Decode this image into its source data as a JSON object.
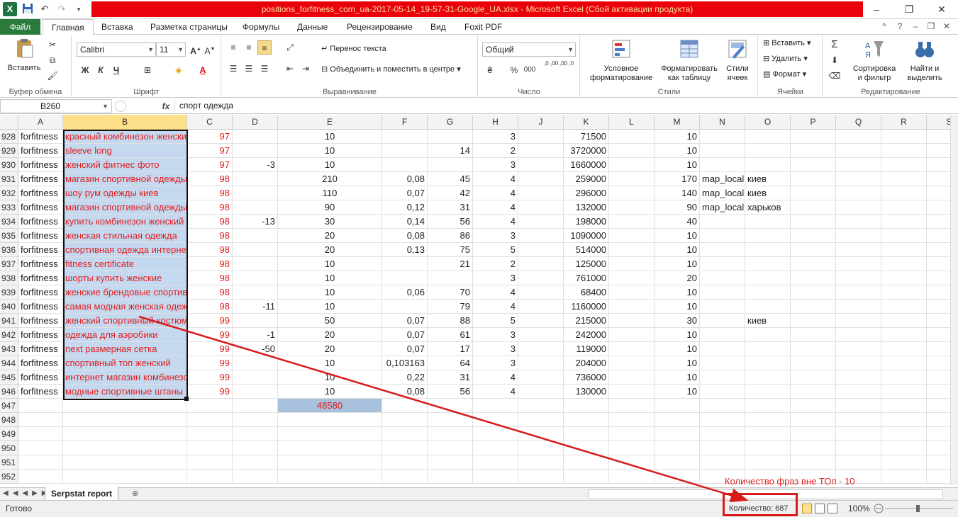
{
  "window": {
    "title": "positions_forfitness_com_ua-2017-05-14_19-57-31-Google_UA.xlsx  -  Microsoft Excel (Сбой активации продукта)",
    "app_icon": "X",
    "minimize": "–",
    "restore": "❐",
    "close": "✕"
  },
  "tabs": {
    "file": "Файл",
    "items": [
      "Главная",
      "Вставка",
      "Разметка страницы",
      "Формулы",
      "Данные",
      "Рецензирование",
      "Вид",
      "Foxit PDF"
    ]
  },
  "ribbon": {
    "clipboard": {
      "label": "Буфер обмена",
      "paste": "Вставить"
    },
    "font": {
      "label": "Шрифт",
      "name": "Calibri",
      "size": "11",
      "bold": "Ж",
      "italic": "К",
      "underline": "Ч"
    },
    "alignment": {
      "label": "Выравнивание",
      "wrap": "Перенос текста",
      "merge": "Объединить и поместить в центре"
    },
    "number": {
      "label": "Число",
      "format": "Общий",
      "percent": "%",
      "thousands": "000",
      "inc_decimal": ",0 ,00",
      "dec_decimal": ",00 ,0"
    },
    "styles": {
      "label": "Стили",
      "conditional": [
        "Условное",
        "форматирование"
      ],
      "as_table": [
        "Форматировать",
        "как таблицу"
      ],
      "cell_styles": [
        "Стили",
        "ячеек"
      ]
    },
    "cells": {
      "label": "Ячейки",
      "insert": "Вставить",
      "delete": "Удалить",
      "format": "Формат"
    },
    "editing": {
      "label": "Редактирование",
      "sort": [
        "Сортировка",
        "и фильтр"
      ],
      "find": [
        "Найти и",
        "выделить"
      ],
      "sigma": "Σ"
    }
  },
  "formula_bar": {
    "name_box": "B260",
    "fx": "fx",
    "content": "спорт одежда"
  },
  "columns": [
    "A",
    "B",
    "C",
    "D",
    "E",
    "F",
    "G",
    "H",
    "J",
    "K",
    "L",
    "M",
    "N",
    "O",
    "P",
    "Q",
    "R",
    "S"
  ],
  "rows": [
    {
      "n": "928",
      "a": "forfitness",
      "b": "красный комбинезон женский",
      "c": "97",
      "d": "",
      "e": "10",
      "f": "",
      "g": "",
      "h": "3",
      "k": "71500",
      "m": "10",
      "n2": "",
      "o": ""
    },
    {
      "n": "929",
      "a": "forfitness",
      "b": "sleeve long",
      "c": "97",
      "d": "",
      "e": "10",
      "f": "",
      "g": "14",
      "h": "2",
      "k": "3720000",
      "m": "10",
      "n2": "",
      "o": ""
    },
    {
      "n": "930",
      "a": "forfitness",
      "b": "женский фитнес фото",
      "c": "97",
      "d": "-3",
      "e": "10",
      "f": "",
      "g": "",
      "h": "3",
      "k": "1660000",
      "m": "10",
      "n2": "",
      "o": ""
    },
    {
      "n": "931",
      "a": "forfitness",
      "b": "магазин спортивной одежды",
      "c": "98",
      "d": "",
      "e": "210",
      "f": "0,08",
      "g": "45",
      "h": "4",
      "k": "259000",
      "m": "170",
      "n2": "map_local",
      "o": "киев"
    },
    {
      "n": "932",
      "a": "forfitness",
      "b": "шоу рум одежды киев",
      "c": "98",
      "d": "",
      "e": "110",
      "f": "0,07",
      "g": "42",
      "h": "4",
      "k": "296000",
      "m": "140",
      "n2": "map_local",
      "o": "киев"
    },
    {
      "n": "933",
      "a": "forfitness",
      "b": "магазин спортивной одежды",
      "c": "98",
      "d": "",
      "e": "90",
      "f": "0,12",
      "g": "31",
      "h": "4",
      "k": "132000",
      "m": "90",
      "n2": "map_local",
      "o": "харьков"
    },
    {
      "n": "934",
      "a": "forfitness",
      "b": "купить комбинезон женский",
      "c": "98",
      "d": "-13",
      "e": "30",
      "f": "0,14",
      "g": "56",
      "h": "4",
      "k": "198000",
      "m": "40",
      "n2": "",
      "o": ""
    },
    {
      "n": "935",
      "a": "forfitness",
      "b": "женская стильная одежда",
      "c": "98",
      "d": "",
      "e": "20",
      "f": "0,08",
      "g": "86",
      "h": "3",
      "k": "1090000",
      "m": "10",
      "n2": "",
      "o": ""
    },
    {
      "n": "936",
      "a": "forfitness",
      "b": "спортивная одежда интернет",
      "c": "98",
      "d": "",
      "e": "20",
      "f": "0,13",
      "g": "75",
      "h": "5",
      "k": "514000",
      "m": "10",
      "n2": "",
      "o": ""
    },
    {
      "n": "937",
      "a": "forfitness",
      "b": "fitness certificate",
      "c": "98",
      "d": "",
      "e": "10",
      "f": "",
      "g": "21",
      "h": "2",
      "k": "125000",
      "m": "10",
      "n2": "",
      "o": ""
    },
    {
      "n": "938",
      "a": "forfitness",
      "b": "шорты купить женские",
      "c": "98",
      "d": "",
      "e": "10",
      "f": "",
      "g": "",
      "h": "3",
      "k": "761000",
      "m": "20",
      "n2": "",
      "o": ""
    },
    {
      "n": "939",
      "a": "forfitness",
      "b": "женские брендовые спортивные",
      "c": "98",
      "d": "",
      "e": "10",
      "f": "0,06",
      "g": "70",
      "h": "4",
      "k": "68400",
      "m": "10",
      "n2": "",
      "o": ""
    },
    {
      "n": "940",
      "a": "forfitness",
      "b": "самая модная женская одежда",
      "c": "98",
      "d": "-11",
      "e": "10",
      "f": "",
      "g": "79",
      "h": "4",
      "k": "1160000",
      "m": "10",
      "n2": "",
      "o": ""
    },
    {
      "n": "941",
      "a": "forfitness",
      "b": "женский спортивный костюм",
      "c": "99",
      "d": "",
      "e": "50",
      "f": "0,07",
      "g": "88",
      "h": "5",
      "k": "215000",
      "m": "30",
      "n2": "",
      "o": "киев"
    },
    {
      "n": "942",
      "a": "forfitness",
      "b": "одежда для аэробики",
      "c": "99",
      "d": "-1",
      "e": "20",
      "f": "0,07",
      "g": "61",
      "h": "3",
      "k": "242000",
      "m": "10",
      "n2": "",
      "o": ""
    },
    {
      "n": "943",
      "a": "forfitness",
      "b": "next размерная сетка",
      "c": "99",
      "d": "-50",
      "e": "20",
      "f": "0,07",
      "g": "17",
      "h": "3",
      "k": "119000",
      "m": "10",
      "n2": "",
      "o": ""
    },
    {
      "n": "944",
      "a": "forfitness",
      "b": "спортивный топ женский",
      "c": "99",
      "d": "",
      "e": "10",
      "f": "0,103163",
      "g": "64",
      "h": "3",
      "k": "204000",
      "m": "10",
      "n2": "",
      "o": ""
    },
    {
      "n": "945",
      "a": "forfitness",
      "b": "интернет магазин комбинезонов",
      "c": "99",
      "d": "",
      "e": "10",
      "f": "0,22",
      "g": "31",
      "h": "4",
      "k": "736000",
      "m": "10",
      "n2": "",
      "o": ""
    },
    {
      "n": "946",
      "a": "forfitness",
      "b": "модные спортивные штаны",
      "c": "99",
      "d": "",
      "e": "10",
      "f": "0,08",
      "g": "56",
      "h": "4",
      "k": "130000",
      "m": "10",
      "n2": "",
      "o": ""
    },
    {
      "n": "947",
      "a": "",
      "b": "",
      "c": "",
      "d": "",
      "e": "48580",
      "f": "",
      "g": "",
      "h": "",
      "k": "",
      "m": "",
      "n2": "",
      "o": ""
    },
    {
      "n": "948",
      "a": "",
      "b": "",
      "c": "",
      "d": "",
      "e": "",
      "f": "",
      "g": "",
      "h": "",
      "k": "",
      "m": "",
      "n2": "",
      "o": ""
    },
    {
      "n": "949",
      "a": "",
      "b": "",
      "c": "",
      "d": "",
      "e": "",
      "f": "",
      "g": "",
      "h": "",
      "k": "",
      "m": "",
      "n2": "",
      "o": ""
    },
    {
      "n": "950",
      "a": "",
      "b": "",
      "c": "",
      "d": "",
      "e": "",
      "f": "",
      "g": "",
      "h": "",
      "k": "",
      "m": "",
      "n2": "",
      "o": ""
    },
    {
      "n": "951",
      "a": "",
      "b": "",
      "c": "",
      "d": "",
      "e": "",
      "f": "",
      "g": "",
      "h": "",
      "k": "",
      "m": "",
      "n2": "",
      "o": ""
    },
    {
      "n": "952",
      "a": "",
      "b": "",
      "c": "",
      "d": "",
      "e": "",
      "f": "",
      "g": "",
      "h": "",
      "k": "",
      "m": "",
      "n2": "",
      "o": ""
    }
  ],
  "sheet": {
    "nav": "◀◀◀▶▶",
    "name": "Serpstat report"
  },
  "status": {
    "ready": "Готово",
    "count": "Количество: 687",
    "zoom": "100%"
  },
  "annotation": {
    "text": "Количество фраз вне ТОп - 10",
    "color": "#e0201f"
  },
  "colors": {
    "file_tab": "#2b7a3d",
    "title_bar": "#e8000b",
    "selection": "#c4d9f0",
    "text_red": "#e0201f"
  }
}
